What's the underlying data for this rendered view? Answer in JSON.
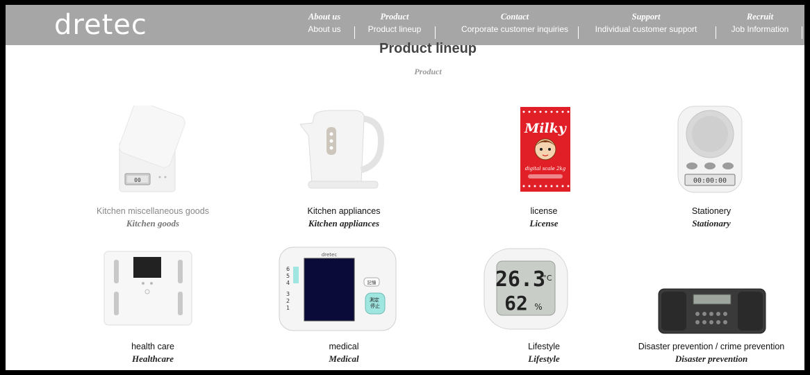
{
  "brand": {
    "logo_text": "dretec"
  },
  "nav": [
    {
      "en": "About us",
      "sub": "About us"
    },
    {
      "en": "Product",
      "sub": "Product lineup"
    },
    {
      "en": "Contact",
      "sub": "Corporate customer inquiries"
    },
    {
      "en": "Support",
      "sub": "Individual customer support"
    },
    {
      "en": "Recruit",
      "sub": "Job Information"
    }
  ],
  "page": {
    "title": "Product lineup",
    "subtitle": "Product"
  },
  "products": [
    {
      "label": "Kitchen miscellaneous goods",
      "label_en": "Kitchen goods",
      "icon": "kitchen-scale-icon"
    },
    {
      "label": "Kitchen appliances",
      "label_en": "Kitchen appliances",
      "icon": "kettle-icon"
    },
    {
      "label": "license",
      "label_en": "License",
      "icon": "milky-scale-icon",
      "pkg_brand": "Milky",
      "pkg_tag": "digital scale 2kg"
    },
    {
      "label": "Stationery",
      "label_en": "Stationary",
      "icon": "timer-icon",
      "display": "00:00:00"
    },
    {
      "label": "health care",
      "label_en": "Healthcare",
      "icon": "body-scale-icon"
    },
    {
      "label": "medical",
      "label_en": "Medical",
      "icon": "blood-pressure-monitor-icon",
      "brand": "dretec",
      "scale": [
        "6",
        "5",
        "4",
        "3",
        "2",
        "1"
      ],
      "btn_mem": "記憶",
      "btn_stop": "測定\n停止"
    },
    {
      "label": "Lifestyle",
      "label_en": "Lifestyle",
      "icon": "thermo-hygrometer-icon",
      "temp": "26.3",
      "temp_unit": "°C",
      "hum": "62",
      "hum_unit": "%"
    },
    {
      "label": "Disaster prevention / crime prevention",
      "label_en": "Disaster prevention",
      "icon": "radio-icon"
    }
  ]
}
